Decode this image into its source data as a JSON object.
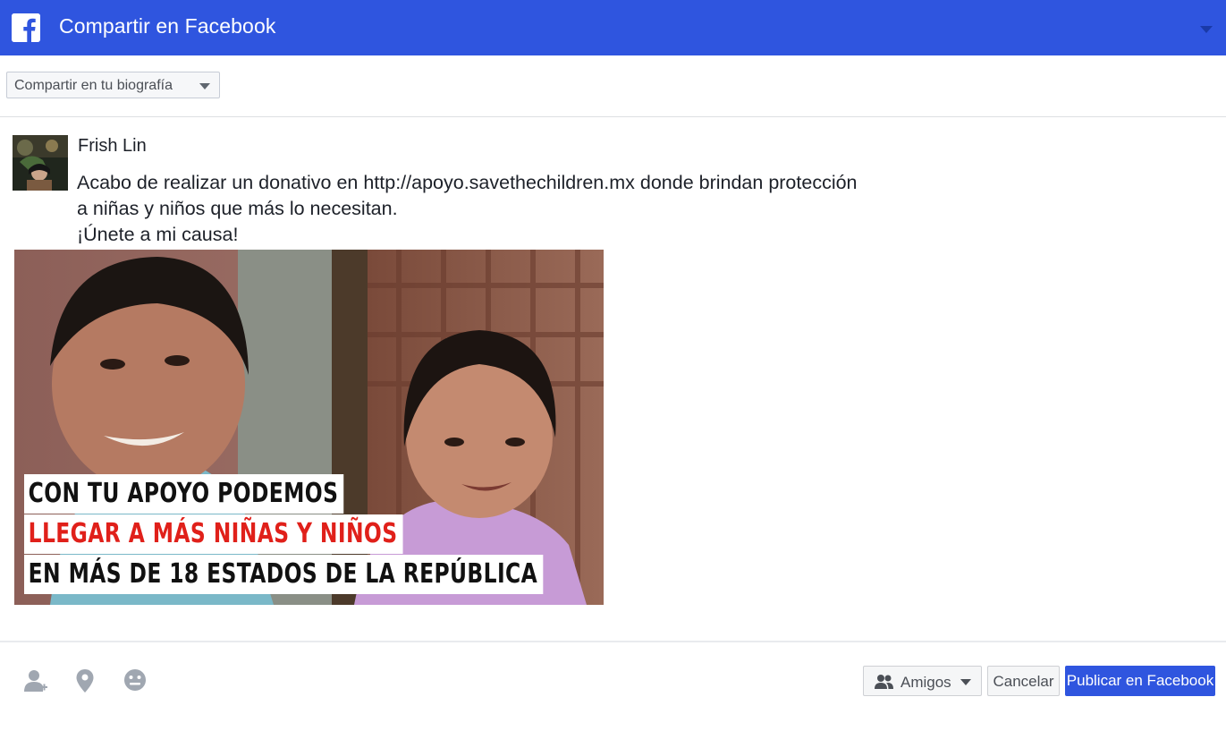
{
  "header": {
    "title": "Compartir en Facebook",
    "logo": "facebook-logo",
    "brand_color": "#2f55df"
  },
  "share_target": {
    "selected": "Compartir en tu biografía"
  },
  "post": {
    "user_name": "Frish Lin",
    "text_lines": [
      "Acabo de realizar un donativo en http://apoyo.savethechildren.mx donde brindan protección",
      "a niñas y niños que más lo necesitan.",
      "¡Únete a mi causa!"
    ],
    "attachment": {
      "overlay_lines": [
        "CON TU APOYO PODEMOS",
        "LLEGAR A MÁS NIÑAS Y NIÑOS",
        "EN MÁS DE 18 ESTADOS DE LA REPÚBLICA"
      ],
      "highlight_color": "#e0201a"
    }
  },
  "footer": {
    "icons": [
      "tag-friends-icon",
      "location-pin-icon",
      "feeling-smiley-icon"
    ],
    "audience_label": "Amigos",
    "cancel_label": "Cancelar",
    "publish_label": "Publicar en Facebook"
  }
}
